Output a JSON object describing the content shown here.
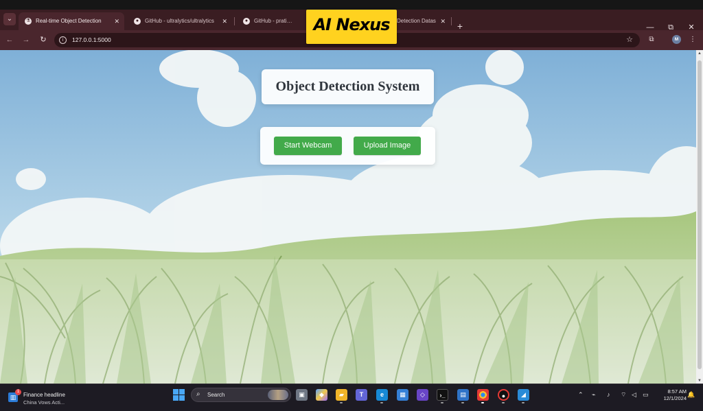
{
  "browser": {
    "tabs": [
      {
        "title": "Real-time Object Detection",
        "icon": "flask-icon"
      },
      {
        "title": "GitHub - ultralytics/ultralytics",
        "icon": "github-icon"
      },
      {
        "title": "GitHub - pratikkayal/Pl",
        "icon": "github-icon"
      },
      {
        "title": "Detection Datas",
        "icon": "document-icon"
      }
    ],
    "url": "127.0.0.1:5000",
    "brand_overlay": "AI Nexus",
    "profile_initial": "M",
    "new_tab": "+"
  },
  "page": {
    "title": "Object Detection System",
    "buttons": {
      "start_webcam": "Start Webcam",
      "upload_image": "Upload Image"
    },
    "button_color": "#42aa4a"
  },
  "taskbar": {
    "news": {
      "title": "Finance headline",
      "subtitle": "China Vows Acti...",
      "count": "1"
    },
    "search": "Search",
    "time": "8:57 AM",
    "date": "12/1/2024",
    "pinned_apps": [
      "file-manager",
      "copilot",
      "file-explorer",
      "teams",
      "edge",
      "store",
      "visual-studio",
      "terminal",
      "notes",
      "chrome",
      "record",
      "paint"
    ]
  },
  "colors": {
    "chrome_dark": "#3a1d22",
    "chrome": "#4a262d",
    "taskbar": "#1d1b23"
  }
}
